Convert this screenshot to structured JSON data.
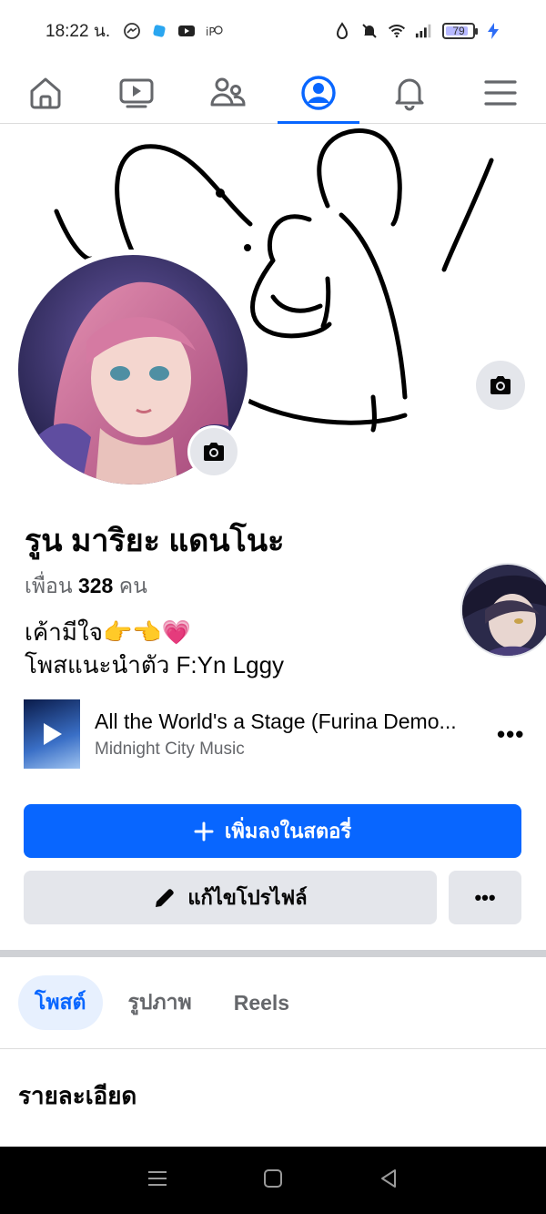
{
  "status_bar": {
    "time": "18:22 น.",
    "battery_level": "79",
    "left_icons": [
      "messenger-icon",
      "app-icon",
      "youtube-icon",
      "ip-icon"
    ],
    "right_icons": [
      "water-drop-icon",
      "mute-icon",
      "wifi-icon",
      "signal-icon",
      "battery-icon",
      "charging-icon"
    ]
  },
  "top_nav": {
    "tabs": [
      {
        "name": "home",
        "icon": "home-icon",
        "active": false
      },
      {
        "name": "video",
        "icon": "video-icon",
        "active": false
      },
      {
        "name": "friends",
        "icon": "friends-icon",
        "active": false
      },
      {
        "name": "profile",
        "icon": "profile-icon",
        "active": true
      },
      {
        "name": "notifications",
        "icon": "bell-icon",
        "active": false
      },
      {
        "name": "menu",
        "icon": "menu-icon",
        "active": false
      }
    ],
    "accent": "#0866ff"
  },
  "profile": {
    "name": "รูน มาริยะ แดนโนะ",
    "friends_prefix": "เพื่อน",
    "friends_count": "328",
    "friends_suffix": "คน",
    "bio_line1": "เค้ามีใจ👉👈💗",
    "bio_line2": "โพสแนะนำตัว F:Yn Lggy"
  },
  "music": {
    "title": "All the World's a Stage (Furina Demo...",
    "artist": "Midnight City Music"
  },
  "actions": {
    "add_story_label": "เพิ่มลงในสตอรี่",
    "edit_profile_label": "แก้ไขโปรไฟล์",
    "more_label": "•••"
  },
  "content_tabs": [
    {
      "label": "โพสต์",
      "active": true
    },
    {
      "label": "รูปภาพ",
      "active": false
    },
    {
      "label": "Reels",
      "active": false
    }
  ],
  "section": {
    "title": "รายละเอียด"
  },
  "colors": {
    "primary": "#0866ff",
    "secondary_button": "#e4e6eb",
    "text_secondary": "#65676b"
  }
}
